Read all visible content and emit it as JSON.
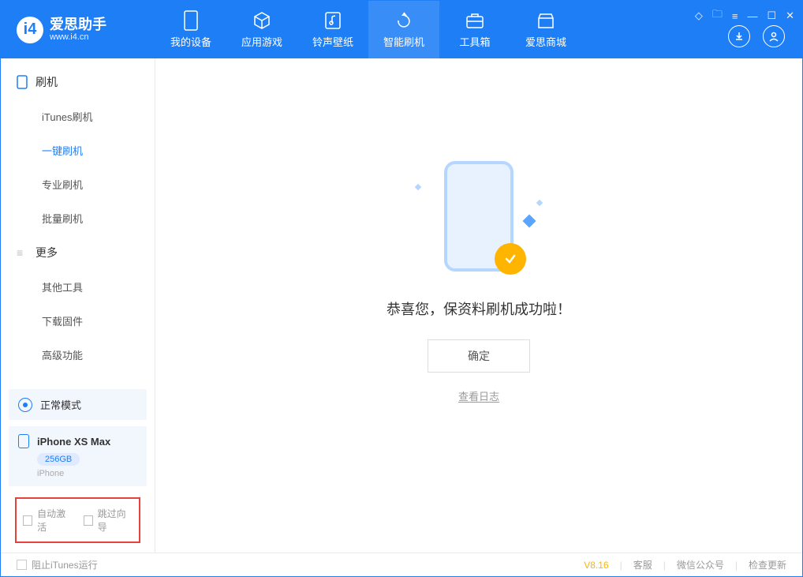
{
  "app": {
    "title": "爱思助手",
    "website": "www.i4.cn"
  },
  "nav": {
    "tabs": [
      {
        "label": "我的设备",
        "icon": "device"
      },
      {
        "label": "应用游戏",
        "icon": "cube"
      },
      {
        "label": "铃声壁纸",
        "icon": "music"
      },
      {
        "label": "智能刷机",
        "icon": "refresh",
        "active": true
      },
      {
        "label": "工具箱",
        "icon": "toolbox"
      },
      {
        "label": "爱思商城",
        "icon": "store"
      }
    ]
  },
  "sidebar": {
    "section1": {
      "title": "刷机"
    },
    "section1_items": [
      {
        "label": "iTunes刷机"
      },
      {
        "label": "一键刷机",
        "active": true
      },
      {
        "label": "专业刷机"
      },
      {
        "label": "批量刷机"
      }
    ],
    "section2": {
      "title": "更多"
    },
    "section2_items": [
      {
        "label": "其他工具"
      },
      {
        "label": "下载固件"
      },
      {
        "label": "高级功能"
      }
    ],
    "mode": {
      "label": "正常模式"
    },
    "device": {
      "name": "iPhone XS Max",
      "storage": "256GB",
      "type": "iPhone"
    },
    "checkboxes": {
      "auto_activate": "自动激活",
      "skip_wizard": "跳过向导"
    }
  },
  "main": {
    "success_text": "恭喜您，保资料刷机成功啦！",
    "ok_button": "确定",
    "view_log": "查看日志"
  },
  "footer": {
    "block_itunes": "阻止iTunes运行",
    "version": "V8.16",
    "links": {
      "service": "客服",
      "wechat": "微信公众号",
      "update": "检查更新"
    }
  }
}
